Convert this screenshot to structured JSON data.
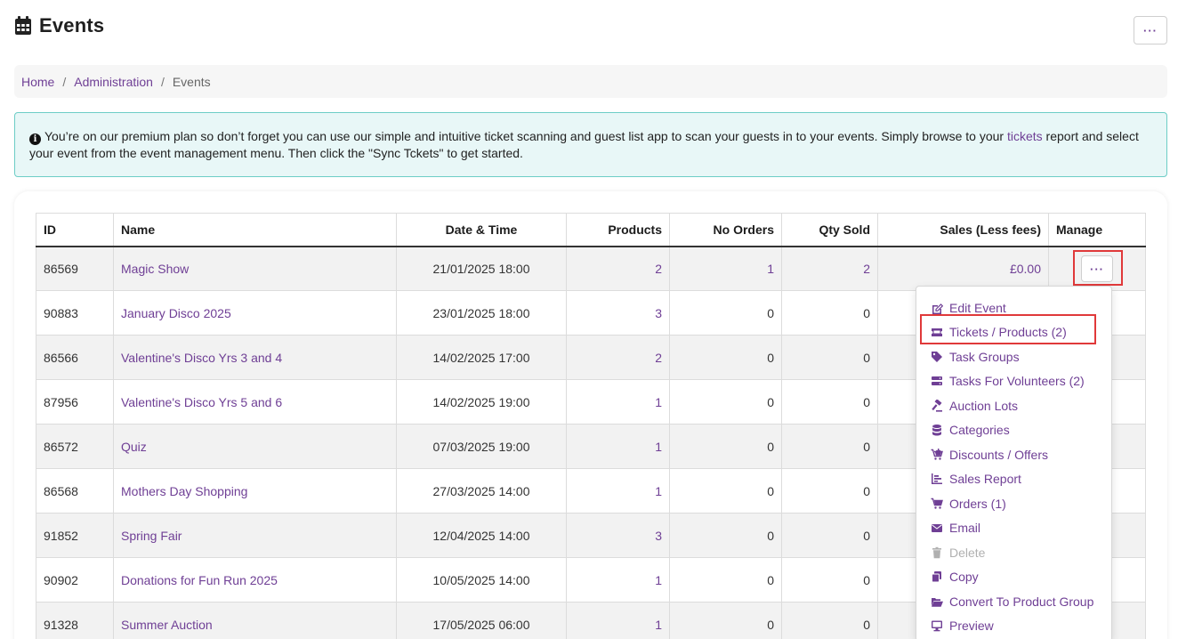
{
  "page": {
    "title": "Events",
    "menu_label": "···"
  },
  "breadcrumb": {
    "items": [
      "Home",
      "Administration"
    ],
    "current": "Events",
    "separator": "/"
  },
  "alert": {
    "text_before": "You’re on our premium plan so don’t forget you can use our simple and intuitive ticket scanning and guest list app to scan your guests in to your events. Simply browse to your ",
    "link": "tickets",
    "text_after": " report and select your event from the event management menu. Then click the \"Sync Tckets\" to get started."
  },
  "table": {
    "headers": [
      "ID",
      "Name",
      "Date & Time",
      "Products",
      "No Orders",
      "Qty Sold",
      "Sales (Less fees)",
      "Manage"
    ],
    "manage_label": "···",
    "rows": [
      {
        "id": "86569",
        "name": "Magic Show",
        "datetime": "21/01/2025 18:00",
        "products": "2",
        "orders": "1",
        "qty": "2",
        "sales": "£0.00"
      },
      {
        "id": "90883",
        "name": "January Disco 2025",
        "datetime": "23/01/2025 18:00",
        "products": "3",
        "orders": "0",
        "qty": "0",
        "sales": ""
      },
      {
        "id": "86566",
        "name": "Valentine's Disco Yrs 3 and 4",
        "datetime": "14/02/2025 17:00",
        "products": "2",
        "orders": "0",
        "qty": "0",
        "sales": ""
      },
      {
        "id": "87956",
        "name": "Valentine's Disco Yrs 5 and 6",
        "datetime": "14/02/2025 19:00",
        "products": "1",
        "orders": "0",
        "qty": "0",
        "sales": ""
      },
      {
        "id": "86572",
        "name": "Quiz",
        "datetime": "07/03/2025 19:00",
        "products": "1",
        "orders": "0",
        "qty": "0",
        "sales": ""
      },
      {
        "id": "86568",
        "name": "Mothers Day Shopping",
        "datetime": "27/03/2025 14:00",
        "products": "1",
        "orders": "0",
        "qty": "0",
        "sales": ""
      },
      {
        "id": "91852",
        "name": "Spring Fair",
        "datetime": "12/04/2025 14:00",
        "products": "3",
        "orders": "0",
        "qty": "0",
        "sales": ""
      },
      {
        "id": "90902",
        "name": "Donations for Fun Run 2025",
        "datetime": "10/05/2025 14:00",
        "products": "1",
        "orders": "0",
        "qty": "0",
        "sales": ""
      },
      {
        "id": "91328",
        "name": "Summer Auction",
        "datetime": "17/05/2025 06:00",
        "products": "1",
        "orders": "0",
        "qty": "0",
        "sales": ""
      }
    ]
  },
  "manage_menu": {
    "items": [
      {
        "label": "Edit Event",
        "icon": "edit-icon"
      },
      {
        "label": "Tickets / Products (2)",
        "icon": "ticket-icon"
      },
      {
        "label": "Task Groups",
        "icon": "tag-icon"
      },
      {
        "label": "Tasks For Volunteers (2)",
        "icon": "list-icon"
      },
      {
        "label": "Auction Lots",
        "icon": "gavel-icon"
      },
      {
        "label": "Categories",
        "icon": "database-icon"
      },
      {
        "label": "Discounts / Offers",
        "icon": "cart-plus-icon"
      },
      {
        "label": "Sales Report",
        "icon": "chart-icon"
      },
      {
        "label": "Orders (1)",
        "icon": "cart-icon"
      },
      {
        "label": "Email",
        "icon": "envelope-icon"
      },
      {
        "label": "Delete",
        "icon": "trash-icon",
        "disabled": true
      },
      {
        "label": "Copy",
        "icon": "copy-icon"
      },
      {
        "label": "Convert To Product Group",
        "icon": "folder-open-icon"
      },
      {
        "label": "Preview",
        "icon": "desktop-icon"
      }
    ]
  },
  "colors": {
    "link": "#6f3f95",
    "alert_bg": "#e8f7f7",
    "alert_border": "#6ccdc6",
    "highlight": "#e0393a"
  }
}
